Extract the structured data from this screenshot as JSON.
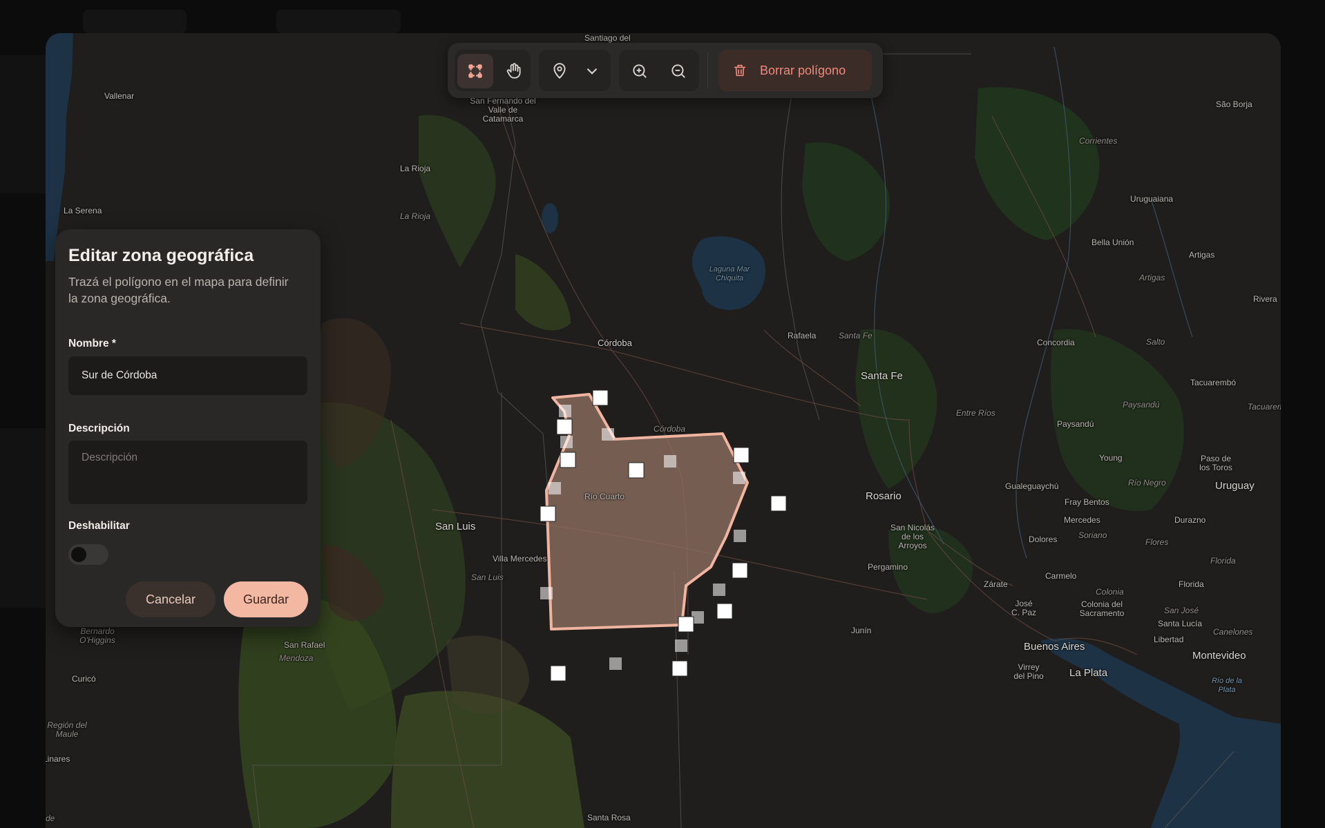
{
  "toolbar": {
    "tools": [
      {
        "name": "draw-polygon-icon",
        "active": true
      },
      {
        "name": "hand-pan-icon",
        "active": false
      },
      {
        "name": "location-pin-icon",
        "active": false
      },
      {
        "name": "chevron-down-icon",
        "active": false
      },
      {
        "name": "zoom-in-icon",
        "active": false
      },
      {
        "name": "zoom-out-icon",
        "active": false
      }
    ],
    "delete_label": "Borrar polígono",
    "delete_icon": "trash-icon"
  },
  "panel": {
    "title": "Editar zona geográfica",
    "subtitle": "Trazá el polígono en el mapa para definir la zona geográfica.",
    "name_label": "Nombre *",
    "name_value": "Sur de Córdoba",
    "description_label": "Descripción",
    "description_placeholder": "Descripción",
    "disable_label": "Deshabilitar",
    "disable_value": false,
    "cancel_label": "Cancelar",
    "save_label": "Guardar"
  },
  "map": {
    "labels": {
      "santiago": "Santiago del",
      "vallenar": "Vallenar",
      "san_fernando": "San Fernando del Valle de Catamarca",
      "sao_borja": "São Borja",
      "corrientes": "Corrientes",
      "la_rioja_city": "La Rioja",
      "la_rioja_region": "La Rioja",
      "la_serena": "La Serena",
      "uruguaiana": "Uruguaiana",
      "bella_union": "Bella Unión",
      "artigas_city": "Artigas",
      "artigas_region": "Artigas",
      "laguna": "Laguna Mar Chiquita",
      "rivera": "Rivera",
      "rafaela": "Rafaela",
      "santa_fe_region": "Santa Fe",
      "cordoba_city": "Córdoba",
      "concordia": "Concordia",
      "salto": "Salto",
      "santa_fe_city": "Santa Fe",
      "tacuarembo": "Tacuarembó",
      "entre_rios": "Entre Ríos",
      "paysandu_region": "Paysandú",
      "tacuarem": "Tacuarem",
      "cordoba_region": "Córdoba",
      "paysandu_city": "Paysandú",
      "young": "Young",
      "paso_toros": "Paso de los Toros",
      "rio_cuarto": "Río Cuarto",
      "gualeguaychu": "Gualeguaychú",
      "rio_negro": "Río Negro",
      "uruguay": "Uruguay",
      "rosario": "Rosario",
      "fray_bentos": "Fray Bentos",
      "san_luis_city": "San Luis",
      "mercedes": "Mercedes",
      "durazno": "Durazno",
      "san_nicolas": "San Nicolás de los Arroyos",
      "soriano": "Soriano",
      "dolores": "Dolores",
      "flores": "Flores",
      "villa_mercedes": "Villa Mercedes",
      "pergamino": "Pergamino",
      "florida_region": "Florida",
      "san_luis_region": "San Luis",
      "carmelo": "Carmelo",
      "zarate": "Zárate",
      "florida_city": "Florida",
      "colonia_region": "Colonia",
      "jose_c_paz": "José C. Paz",
      "colonia_city": "Colonia del Sacramento",
      "san_jose": "San José",
      "santa_lucia": "Santa Lucía",
      "canelones": "Canelones",
      "bernardo": "Bernardo O'Higgins",
      "junin": "Junín",
      "libertad": "Libertad",
      "san_rafael": "San Rafael",
      "buenos_aires": "Buenos Aires",
      "montevideo": "Montevideo",
      "mendoza": "Mendoza",
      "virrey": "Virrey del Pino",
      "la_plata": "La Plata",
      "curico": "Curicó",
      "rio_plata": "Río de la Plata",
      "maule": "Región del Maule",
      "linares": "Linares",
      "santa_rosa": "Santa Rosa",
      "de": "de"
    }
  }
}
